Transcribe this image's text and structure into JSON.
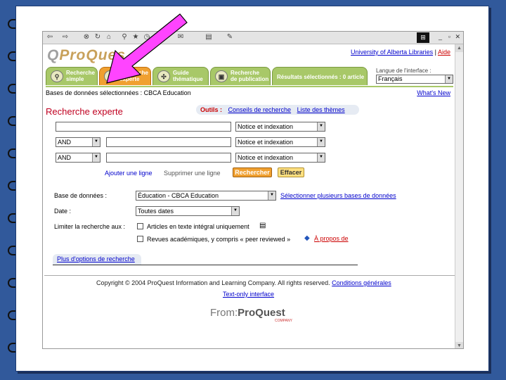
{
  "colors": {
    "slide_bg": "#31599b",
    "tab_green": "#a8c868",
    "tab_orange": "#f0a030",
    "title_red": "#c00020",
    "arrow_magenta": "#ff44ff"
  },
  "toolbar": {
    "icons": [
      "back-arrow-icon",
      "forward-arrow-icon",
      "stop-icon",
      "refresh-icon",
      "home-icon",
      "search-icon",
      "favorites-icon",
      "history-icon",
      "mail-icon",
      "print-icon",
      "edit-icon"
    ]
  },
  "header": {
    "logo_text_a": "Pro",
    "logo_text_b": "Q",
    "logo_text_c": "ues",
    "university_link": "University of Alberta Libraries",
    "separator": "|",
    "aide_link": "Aide"
  },
  "tabs": [
    {
      "line1": "Recherche",
      "line2": "simple"
    },
    {
      "line1": "Recherche",
      "line2": "experte"
    },
    {
      "line1": "Guide",
      "line2": "thématique"
    },
    {
      "line1": "Recherche",
      "line2": "de publication"
    },
    {
      "line1": "Résultats sélectionnés : 0 article",
      "line2": ""
    }
  ],
  "language": {
    "label": "Langue de l'interface :",
    "value": "Français"
  },
  "db_line": "Bases de données sélectionnées : CBCA Education",
  "whats_new": "What's New",
  "page_title": "Recherche experte",
  "outils": {
    "label": "Outils :",
    "link1": "Conseils de recherche",
    "link2": "Liste des thèmes"
  },
  "rows": [
    {
      "op": "",
      "term": "",
      "field": "Notice et indexation"
    },
    {
      "op": "AND",
      "term": "",
      "field": "Notice et indexation"
    },
    {
      "op": "AND",
      "term": "",
      "field": "Notice et indexation"
    }
  ],
  "row_actions": {
    "add_line": "Ajouter une ligne",
    "remove_line": "Supprimer une ligne",
    "search_btn": "Rechercher",
    "clear_btn": "Effacer"
  },
  "options": {
    "db_label": "Base de données :",
    "db_value": "Éducation - CBCA Education",
    "db_multi_link": "Sélectionner plusieurs bases de données",
    "date_label": "Date :",
    "date_value": "Toutes dates",
    "limit_label": "Limiter la recherche aux :",
    "limit1": "Articles en texte intégral uniquement",
    "limit2": "Revues académiques, y compris « peer reviewed »",
    "apropos": "À propos de"
  },
  "more_options": "Plus d'options de recherche",
  "footer": {
    "copyright": "Copyright © 2004 ProQuest Information and Learning Company. All rights reserved.",
    "terms_link": "Conditions générales",
    "text_only": "Text-only interface",
    "from_logo_a": "From:",
    "from_logo_b": "ProQuest",
    "from_logo_sub": "COMPANY"
  }
}
